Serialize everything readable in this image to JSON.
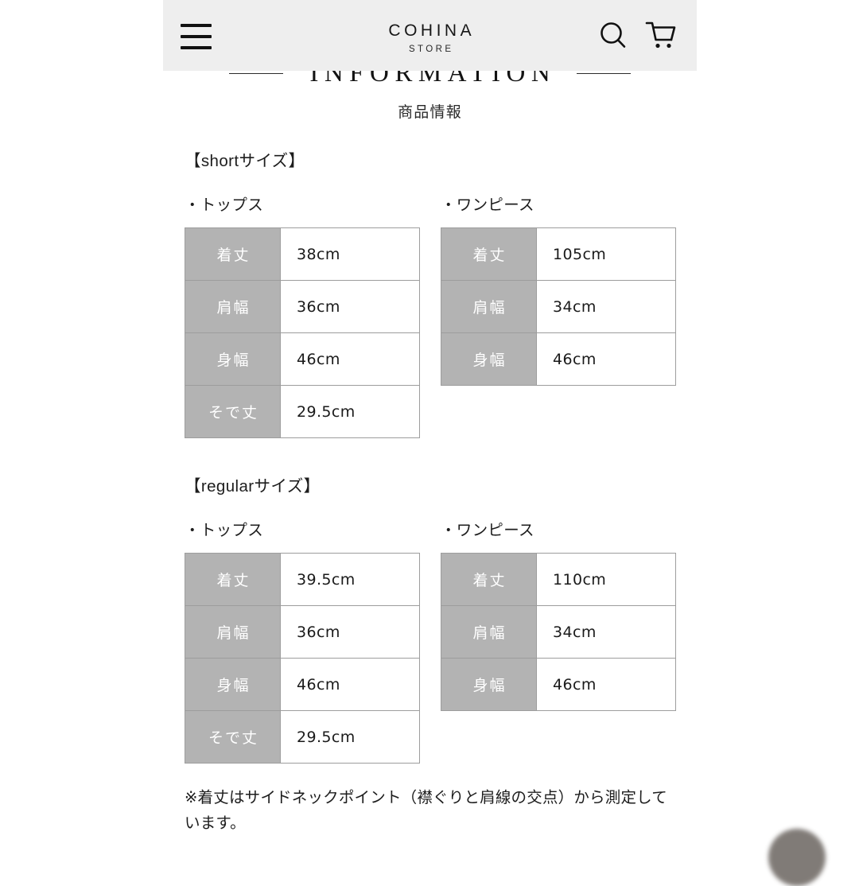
{
  "header": {
    "menu_icon": "hamburger-menu-icon",
    "brand_main": "COHINA",
    "brand_sub": "STORE",
    "search_icon": "search-icon",
    "cart_icon": "shopping-cart-icon"
  },
  "title": {
    "heading": "INFORMATION",
    "subheading": "商品情報"
  },
  "groups": [
    {
      "title": "【shortサイズ】",
      "tops": {
        "col_title": "・トップス",
        "rows": [
          {
            "label": "着丈",
            "value": "38cm"
          },
          {
            "label": "肩幅",
            "value": "36cm"
          },
          {
            "label": "身幅",
            "value": "46cm"
          },
          {
            "label": "そで丈",
            "value": "29.5cm"
          }
        ]
      },
      "dress": {
        "col_title": "・ワンピース",
        "rows": [
          {
            "label": "着丈",
            "value": "105cm"
          },
          {
            "label": "肩幅",
            "value": "34cm"
          },
          {
            "label": "身幅",
            "value": "46cm"
          }
        ]
      }
    },
    {
      "title": "【regularサイズ】",
      "tops": {
        "col_title": "・トップス",
        "rows": [
          {
            "label": "着丈",
            "value": "39.5cm"
          },
          {
            "label": "肩幅",
            "value": "36cm"
          },
          {
            "label": "身幅",
            "value": "46cm"
          },
          {
            "label": "そで丈",
            "value": "29.5cm"
          }
        ]
      },
      "dress": {
        "col_title": "・ワンピース",
        "rows": [
          {
            "label": "着丈",
            "value": "110cm"
          },
          {
            "label": "肩幅",
            "value": "34cm"
          },
          {
            "label": "身幅",
            "value": "46cm"
          }
        ]
      }
    }
  ],
  "note": "※着丈はサイドネックポイント（襟ぐりと肩線の交点）から測定しています。",
  "colors": {
    "header_bg": "#eeeeee",
    "table_label_bg": "#b3b3b3",
    "table_border": "#9d9d9d",
    "text": "#1a1a1a",
    "page_bg": "#ffffff"
  }
}
